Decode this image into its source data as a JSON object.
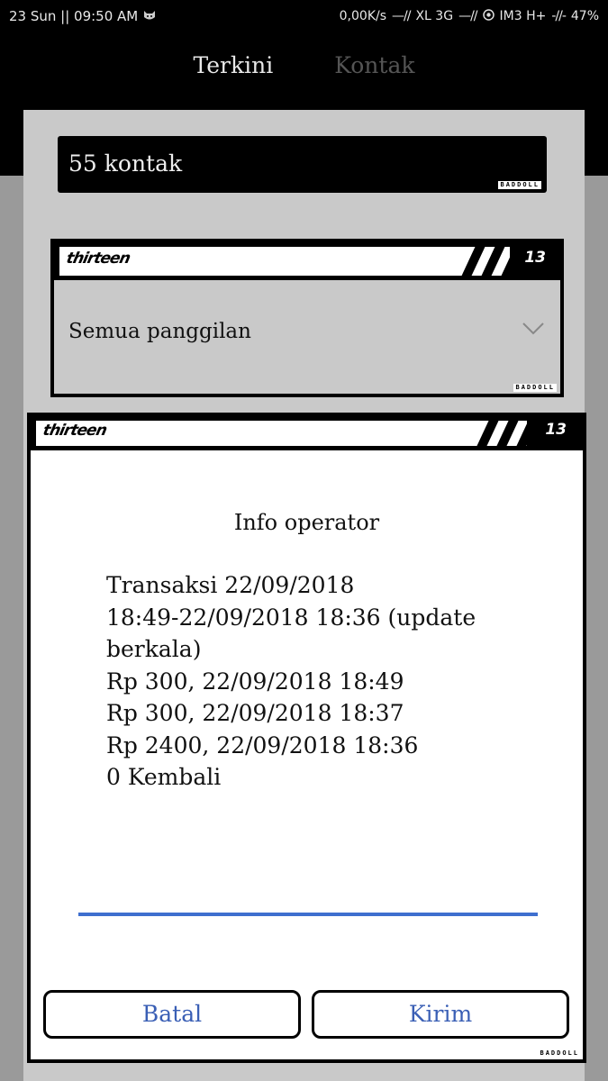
{
  "status_bar": {
    "time": "23 Sun || 09:50 AM",
    "net_speed": "0,00K/s",
    "carrier1": "XL 3G",
    "carrier2": "IM3 H+",
    "battery": "47%"
  },
  "tabs": [
    {
      "label": "Terkini",
      "active": true
    },
    {
      "label": "Kontak",
      "active": false
    }
  ],
  "search": {
    "value": "55 kontak"
  },
  "brand_tag": "BADDOLL",
  "theme_logo": "thirteen",
  "theme_number": "13",
  "dropdown": {
    "selected": "Semua panggilan"
  },
  "dialog": {
    "title": "Info operator",
    "lines": [
      "Transaksi 22/09/2018",
      "18:49-22/09/2018 18:36 (update",
      "berkala)",
      "Rp 300, 22/09/2018 18:49",
      "Rp 300, 22/09/2018 18:37",
      "Rp 2400, 22/09/2018 18:36",
      "0 Kembali"
    ],
    "input_value": "",
    "cancel_label": "Batal",
    "send_label": "Kirim"
  },
  "colors": {
    "accent": "#3e6fcf",
    "button_text": "#3a5fb5",
    "background": "#9a9a9a",
    "panel": "#c9c9c9"
  }
}
